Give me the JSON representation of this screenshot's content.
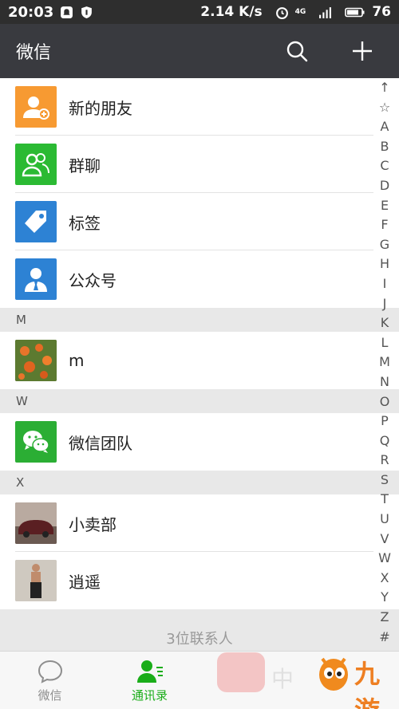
{
  "status_bar": {
    "time": "20:03",
    "speed": "2.14 K/s",
    "network": "4G",
    "battery": "76"
  },
  "header": {
    "title": "微信"
  },
  "contacts": {
    "fixed": [
      {
        "label": "新的朋友",
        "icon": "add-friend-icon",
        "color": "#f79a32"
      },
      {
        "label": "群聊",
        "icon": "group-chat-icon",
        "color": "#2bba33"
      },
      {
        "label": "标签",
        "icon": "tag-icon",
        "color": "#2d82d4"
      },
      {
        "label": "公众号",
        "icon": "official-account-icon",
        "color": "#2d82d4"
      }
    ],
    "sections": [
      {
        "letter": "M",
        "items": [
          {
            "name": "m"
          }
        ]
      },
      {
        "letter": "W",
        "items": [
          {
            "name": "微信团队"
          }
        ]
      },
      {
        "letter": "X",
        "items": [
          {
            "name": "小卖部"
          },
          {
            "name": "逍遥"
          }
        ]
      }
    ],
    "count_text": "3位联系人"
  },
  "index_bar": [
    "↑",
    "☆",
    "A",
    "B",
    "C",
    "D",
    "E",
    "F",
    "G",
    "H",
    "I",
    "J",
    "K",
    "L",
    "M",
    "N",
    "O",
    "P",
    "Q",
    "R",
    "S",
    "T",
    "U",
    "V",
    "W",
    "X",
    "Y",
    "Z",
    "#"
  ],
  "tabs": [
    {
      "label": "微信",
      "icon": "chat-bubble-icon"
    },
    {
      "label": "通讯录",
      "icon": "contacts-icon"
    }
  ],
  "watermark": {
    "text": "中",
    "brand": "九游"
  },
  "colors": {
    "header_bg": "#393a3f",
    "accent": "#1aad19"
  }
}
